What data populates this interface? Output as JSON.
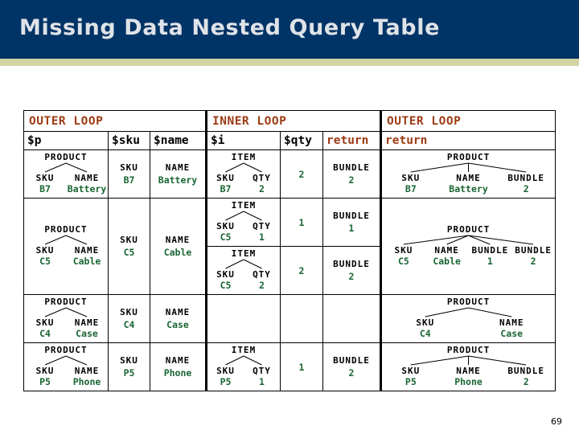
{
  "slide": {
    "title": "Missing Data Nested Query Table",
    "page_number": "69",
    "colors": {
      "banner_bg": "#003366",
      "banner_text": "#dfe3e8",
      "rule": "#d3d3a4",
      "heading_rust": "#9c3b14",
      "value_green": "#1a6633",
      "label_black": "#000000"
    }
  },
  "table": {
    "group_headers": [
      {
        "label": "OUTER LOOP",
        "span": 3
      },
      {
        "label": "INNER LOOP",
        "span": 3
      },
      {
        "label": "OUTER LOOP",
        "span": 1
      }
    ],
    "column_headers": [
      {
        "label": "$p",
        "style": "black"
      },
      {
        "label": "$sku",
        "style": "black"
      },
      {
        "label": "$name",
        "style": "black"
      },
      {
        "label": "$i",
        "style": "black"
      },
      {
        "label": "$qty",
        "style": "black"
      },
      {
        "label": "return",
        "style": "rust"
      },
      {
        "label": "return",
        "style": "rust"
      }
    ],
    "rows": [
      {
        "p": {
          "root": "PRODUCT",
          "children": [
            {
              "name": "SKU",
              "value": "B7"
            },
            {
              "name": "NAME",
              "value": "Battery"
            }
          ]
        },
        "sku": {
          "name": "SKU",
          "value": "B7"
        },
        "name": {
          "name": "NAME",
          "value": "Battery"
        },
        "inner": [
          {
            "i": {
              "root": "ITEM",
              "children": [
                {
                  "name": "SKU",
                  "value": "B7"
                },
                {
                  "name": "QTY",
                  "value": "2"
                }
              ]
            },
            "qty": "2",
            "inner_return": {
              "name": "BUNDLE",
              "value": "2"
            }
          }
        ],
        "outer_return": {
          "root": "PRODUCT",
          "children": [
            {
              "name": "SKU",
              "value": "B7"
            },
            {
              "name": "NAME",
              "value": "Battery"
            },
            {
              "name": "BUNDLE",
              "value": "2"
            }
          ]
        }
      },
      {
        "p": {
          "root": "PRODUCT",
          "children": [
            {
              "name": "SKU",
              "value": "C5"
            },
            {
              "name": "NAME",
              "value": "Cable"
            }
          ]
        },
        "sku": {
          "name": "SKU",
          "value": "C5"
        },
        "name": {
          "name": "NAME",
          "value": "Cable"
        },
        "inner": [
          {
            "i": {
              "root": "ITEM",
              "children": [
                {
                  "name": "SKU",
                  "value": "C5"
                },
                {
                  "name": "QTY",
                  "value": "1"
                }
              ]
            },
            "qty": "1",
            "inner_return": {
              "name": "BUNDLE",
              "value": "1"
            }
          },
          {
            "i": {
              "root": "ITEM",
              "children": [
                {
                  "name": "SKU",
                  "value": "C5"
                },
                {
                  "name": "QTY",
                  "value": "2"
                }
              ]
            },
            "qty": "2",
            "inner_return": {
              "name": "BUNDLE",
              "value": "2"
            }
          }
        ],
        "outer_return": {
          "root": "PRODUCT",
          "children": [
            {
              "name": "SKU",
              "value": "C5"
            },
            {
              "name": "NAME",
              "value": "Cable"
            },
            {
              "name": "BUNDLE",
              "value": "1"
            },
            {
              "name": "BUNDLE",
              "value": "2"
            }
          ]
        }
      },
      {
        "p": {
          "root": "PRODUCT",
          "children": [
            {
              "name": "SKU",
              "value": "C4"
            },
            {
              "name": "NAME",
              "value": "Case"
            }
          ]
        },
        "sku": {
          "name": "SKU",
          "value": "C4"
        },
        "name": {
          "name": "NAME",
          "value": "Case"
        },
        "inner": [
          {
            "i": null,
            "qty": "",
            "inner_return": null
          }
        ],
        "outer_return": {
          "root": "PRODUCT",
          "children": [
            {
              "name": "SKU",
              "value": "C4"
            },
            {
              "name": "NAME",
              "value": "Case"
            }
          ]
        }
      },
      {
        "p": {
          "root": "PRODUCT",
          "children": [
            {
              "name": "SKU",
              "value": "P5"
            },
            {
              "name": "NAME",
              "value": "Phone"
            }
          ]
        },
        "sku": {
          "name": "SKU",
          "value": "P5"
        },
        "name": {
          "name": "NAME",
          "value": "Phone"
        },
        "inner": [
          {
            "i": {
              "root": "ITEM",
              "children": [
                {
                  "name": "SKU",
                  "value": "P5"
                },
                {
                  "name": "QTY",
                  "value": "1"
                }
              ]
            },
            "qty": "1",
            "inner_return": {
              "name": "BUNDLE",
              "value": "2"
            }
          }
        ],
        "outer_return": {
          "root": "PRODUCT",
          "children": [
            {
              "name": "SKU",
              "value": "P5"
            },
            {
              "name": "NAME",
              "value": "Phone"
            },
            {
              "name": "BUNDLE",
              "value": "2"
            }
          ]
        }
      }
    ]
  }
}
